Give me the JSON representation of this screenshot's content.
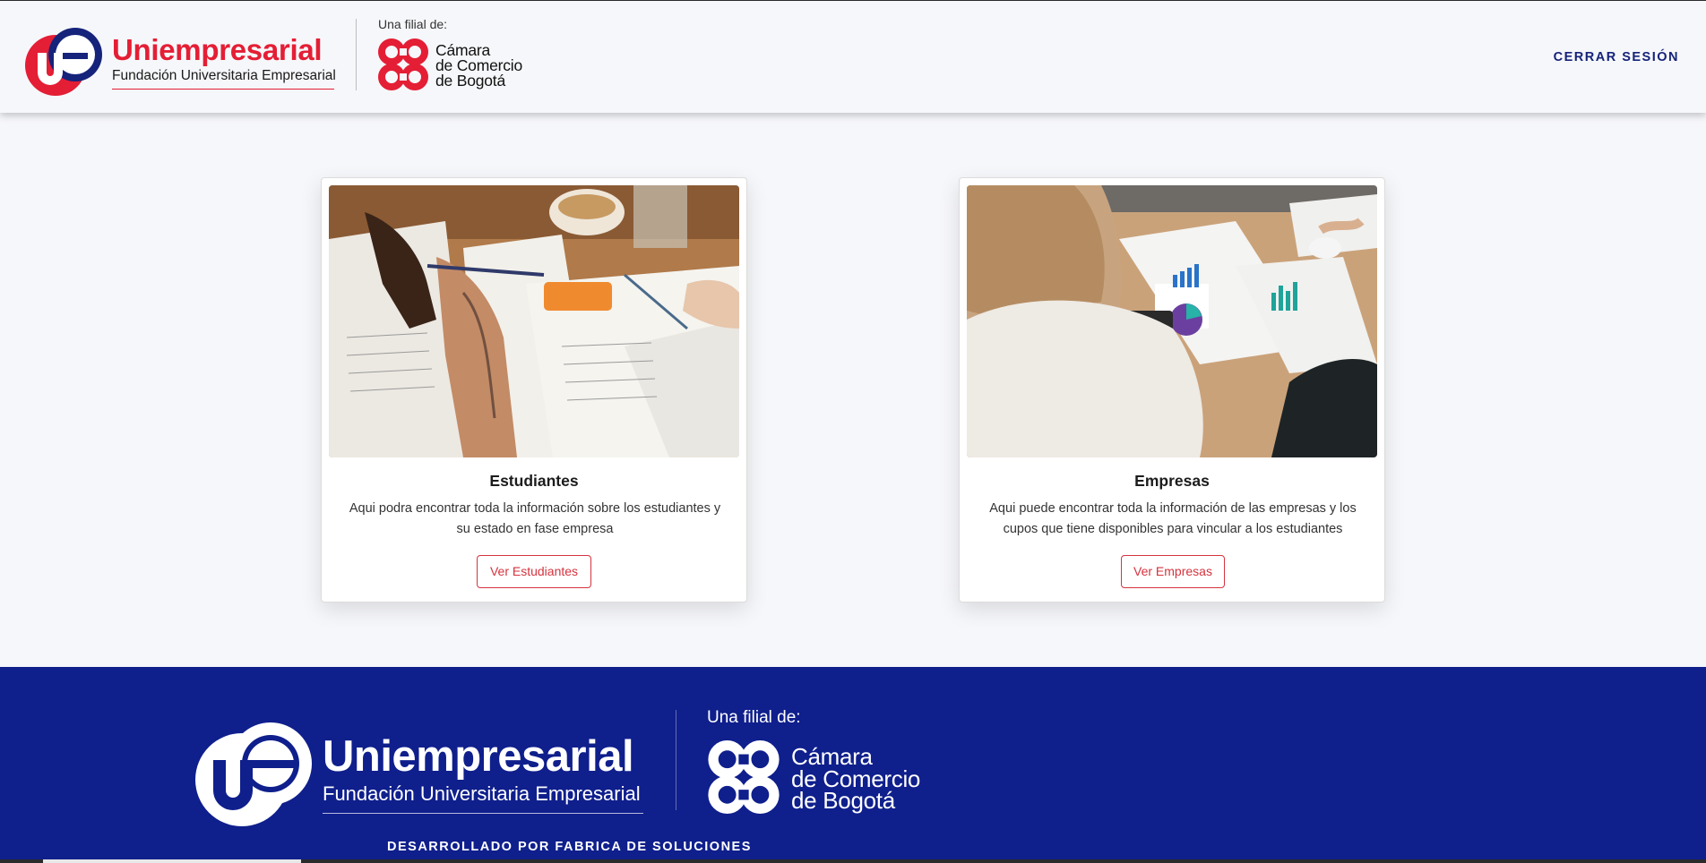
{
  "header": {
    "brand_name": "Uniempresarial",
    "brand_subtitle": "Fundación Universitaria Empresarial",
    "filial_label": "Una filial de:",
    "ccb_lines": [
      "Cámara",
      "de Comercio",
      "de Bogotá"
    ],
    "logout_label": "CERRAR SESIÓN"
  },
  "cards": [
    {
      "title": "Estudiantes",
      "description": "Aqui podra encontrar toda la información sobre los estudiantes y su estado en fase empresa",
      "button_label": "Ver Estudiantes"
    },
    {
      "title": "Empresas",
      "description": "Aqui puede encontrar toda la información de las empresas y los cupos que tiene disponibles para vincular a los estudiantes",
      "button_label": "Ver Empresas"
    }
  ],
  "footer": {
    "brand_name": "Uniempresarial",
    "brand_subtitle": "Fundación Universitaria Empresarial",
    "filial_label": "Una filial de:",
    "ccb_lines": [
      "Cámara",
      "de Comercio",
      "de Bogotá"
    ],
    "developer_credit": "DESARROLLADO POR FABRICA DE SOLUCIONES"
  },
  "colors": {
    "brand_red": "#e41e35",
    "brand_navy": "#15237a",
    "footer_blue": "#0f1f8c"
  }
}
